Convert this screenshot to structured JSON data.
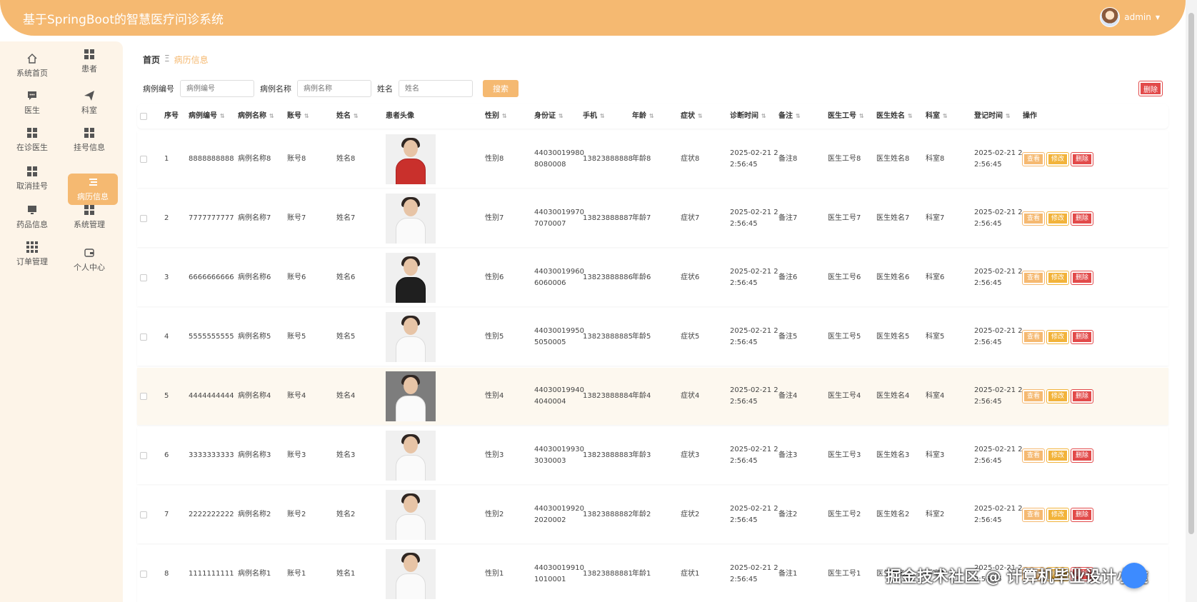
{
  "app": {
    "title": "基于SpringBoot的智慧医疗问诊系统",
    "user": "admin"
  },
  "sidebar": {
    "items": [
      {
        "label": "系统首页",
        "icon": "home-icon"
      },
      {
        "label": "患者",
        "icon": "grid-icon"
      },
      {
        "label": "医生",
        "icon": "chat-icon"
      },
      {
        "label": "科室",
        "icon": "send-icon"
      },
      {
        "label": "在诊医生",
        "icon": "grid-icon"
      },
      {
        "label": "挂号信息",
        "icon": "grid-icon"
      },
      {
        "label": "取消挂号",
        "icon": "grid-icon"
      },
      {
        "label": "病历信息",
        "icon": "list-icon",
        "active": true
      },
      {
        "label": "药品信息",
        "icon": "monitor-icon"
      },
      {
        "label": "系统管理",
        "icon": "grid-icon"
      },
      {
        "label": "订单管理",
        "icon": "grid9-icon"
      },
      {
        "label": "个人中心",
        "icon": "card-icon"
      }
    ]
  },
  "breadcrumb": {
    "home": "首页",
    "separator": "Ξ",
    "current": "病历信息"
  },
  "search": {
    "fields": [
      {
        "label": "病例编号",
        "placeholder": "病例编号"
      },
      {
        "label": "病例名称",
        "placeholder": "病例名称"
      },
      {
        "label": "姓名",
        "placeholder": "姓名"
      }
    ],
    "button": "搜索",
    "delete": "删除"
  },
  "table": {
    "columns": [
      "序号",
      "病例编号",
      "病例名称",
      "账号",
      "姓名",
      "患者头像",
      "性别",
      "身份证",
      "手机",
      "年龄",
      "症状",
      "诊断时间",
      "备注",
      "医生工号",
      "医生姓名",
      "科室",
      "登记时间",
      "操作"
    ],
    "actions": {
      "view": "查看",
      "edit": "修改",
      "delete": "删除"
    },
    "rows": [
      {
        "no": "1",
        "code": "8888888888",
        "name": "病例名称8",
        "account": "账号8",
        "patient": "姓名8",
        "gender": "性别8",
        "id1": "44030019980",
        "id2": "8080008",
        "phone": "13823888888",
        "age": "年龄8",
        "symptom": "症状8",
        "diag1": "2025-02-21 2",
        "diag2": "2:56:45",
        "note": "备注8",
        "doc_no": "医生工号8",
        "doc_name": "医生姓名8",
        "dept": "科室8",
        "reg1": "2025-02-21 2",
        "reg2": "2:56:45"
      },
      {
        "no": "2",
        "code": "7777777777",
        "name": "病例名称7",
        "account": "账号7",
        "patient": "姓名7",
        "gender": "性别7",
        "id1": "44030019970",
        "id2": "7070007",
        "phone": "13823888887",
        "age": "年龄7",
        "symptom": "症状7",
        "diag1": "2025-02-21 2",
        "diag2": "2:56:45",
        "note": "备注7",
        "doc_no": "医生工号7",
        "doc_name": "医生姓名7",
        "dept": "科室7",
        "reg1": "2025-02-21 2",
        "reg2": "2:56:45"
      },
      {
        "no": "3",
        "code": "6666666666",
        "name": "病例名称6",
        "account": "账号6",
        "patient": "姓名6",
        "gender": "性别6",
        "id1": "44030019960",
        "id2": "6060006",
        "phone": "13823888886",
        "age": "年龄6",
        "symptom": "症状6",
        "diag1": "2025-02-21 2",
        "diag2": "2:56:45",
        "note": "备注6",
        "doc_no": "医生工号6",
        "doc_name": "医生姓名6",
        "dept": "科室6",
        "reg1": "2025-02-21 2",
        "reg2": "2:56:45"
      },
      {
        "no": "4",
        "code": "5555555555",
        "name": "病例名称5",
        "account": "账号5",
        "patient": "姓名5",
        "gender": "性别5",
        "id1": "44030019950",
        "id2": "5050005",
        "phone": "13823888885",
        "age": "年龄5",
        "symptom": "症状5",
        "diag1": "2025-02-21 2",
        "diag2": "2:56:45",
        "note": "备注5",
        "doc_no": "医生工号5",
        "doc_name": "医生姓名5",
        "dept": "科室5",
        "reg1": "2025-02-21 2",
        "reg2": "2:56:45"
      },
      {
        "no": "5",
        "code": "4444444444",
        "name": "病例名称4",
        "account": "账号4",
        "patient": "姓名4",
        "gender": "性别4",
        "id1": "44030019940",
        "id2": "4040004",
        "phone": "13823888884",
        "age": "年龄4",
        "symptom": "症状4",
        "diag1": "2025-02-21 2",
        "diag2": "2:56:45",
        "note": "备注4",
        "doc_no": "医生工号4",
        "doc_name": "医生姓名4",
        "dept": "科室4",
        "reg1": "2025-02-21 2",
        "reg2": "2:56:45"
      },
      {
        "no": "6",
        "code": "3333333333",
        "name": "病例名称3",
        "account": "账号3",
        "patient": "姓名3",
        "gender": "性别3",
        "id1": "44030019930",
        "id2": "3030003",
        "phone": "13823888883",
        "age": "年龄3",
        "symptom": "症状3",
        "diag1": "2025-02-21 2",
        "diag2": "2:56:45",
        "note": "备注3",
        "doc_no": "医生工号3",
        "doc_name": "医生姓名3",
        "dept": "科室3",
        "reg1": "2025-02-21 2",
        "reg2": "2:56:45"
      },
      {
        "no": "7",
        "code": "2222222222",
        "name": "病例名称2",
        "account": "账号2",
        "patient": "姓名2",
        "gender": "性别2",
        "id1": "44030019920",
        "id2": "2020002",
        "phone": "13823888882",
        "age": "年龄2",
        "symptom": "症状2",
        "diag1": "2025-02-21 2",
        "diag2": "2:56:45",
        "note": "备注2",
        "doc_no": "医生工号2",
        "doc_name": "医生姓名2",
        "dept": "科室2",
        "reg1": "2025-02-21 2",
        "reg2": "2:56:45"
      },
      {
        "no": "8",
        "code": "1111111111",
        "name": "病例名称1",
        "account": "账号1",
        "patient": "姓名1",
        "gender": "性别1",
        "id1": "44030019910",
        "id2": "1010001",
        "phone": "13823888881",
        "age": "年龄1",
        "symptom": "症状1",
        "diag1": "2025-02-21 2",
        "diag2": "2:56:45",
        "note": "备注1",
        "doc_no": "医生工号1",
        "doc_name": "医生姓名1",
        "dept": "科室1",
        "reg1": "2025-02-21 2",
        "reg2": "2:56:45"
      }
    ]
  },
  "watermark": "掘金技术社区 @ 计算机毕业设计小途",
  "colors": {
    "accent": "#f5b971",
    "sidebar_bg": "#fdf4e8",
    "danger": "#e24a4a",
    "warning": "#f2b33a"
  }
}
